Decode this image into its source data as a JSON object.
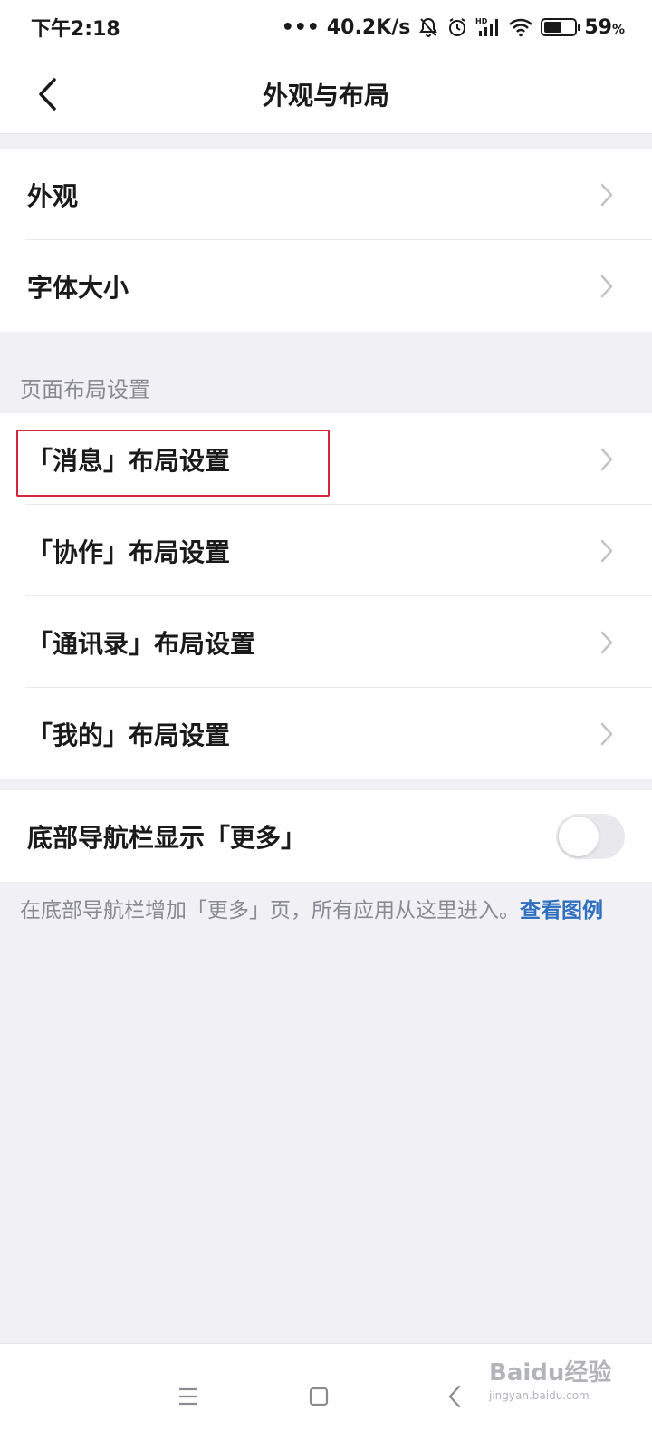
{
  "status_bar": {
    "time": "下午2:18",
    "speed": "40.2K/s",
    "hd": "HD",
    "battery_percent": "59",
    "battery_symbol": "%",
    "battery_level": 0.59
  },
  "navbar": {
    "title": "外观与布局"
  },
  "group1": {
    "items": [
      {
        "label": "外观"
      },
      {
        "label": "字体大小"
      }
    ]
  },
  "section": {
    "label": "页面布局设置"
  },
  "group2": {
    "items": [
      {
        "label": "「消息」布局设置"
      },
      {
        "label": "「协作」布局设置"
      },
      {
        "label": "「通讯录」布局设置"
      },
      {
        "label": "「我的」布局设置"
      }
    ]
  },
  "group3": {
    "toggle_label": "底部导航栏显示「更多」",
    "toggle_on": false
  },
  "footnote": {
    "text": "在底部导航栏增加「更多」页，所有应用从这里进入。",
    "link": "查看图例"
  },
  "watermark": {
    "brand": "Baidu经验",
    "url": "jingyan.baidu.com"
  },
  "colors": {
    "accent_link": "#2f6fbf",
    "highlight_box": "#d6243a",
    "background": "#f0f0f5"
  }
}
